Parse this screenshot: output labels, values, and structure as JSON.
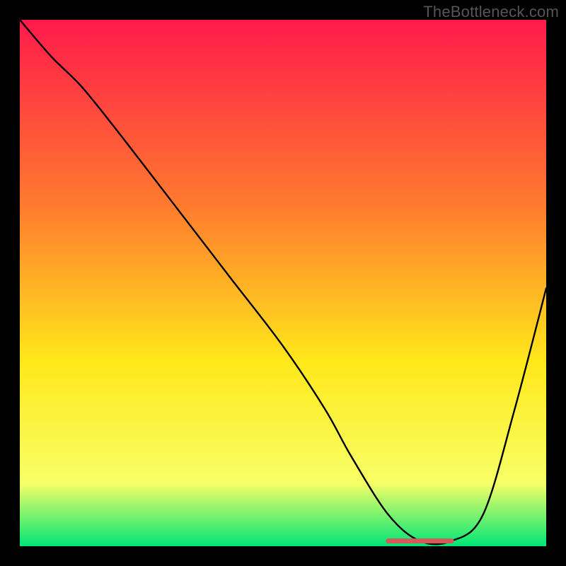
{
  "watermark": "TheBottleneck.com",
  "colors": {
    "background": "#000000",
    "gradient_top": "#ff1a4b",
    "gradient_mid1": "#ff7a2e",
    "gradient_mid2": "#ffe81a",
    "gradient_mid3": "#f7ff66",
    "gradient_bottom": "#00e676",
    "curve": "#000000",
    "flat_highlight": "#d65a5a"
  },
  "chart_data": {
    "type": "line",
    "title": "",
    "xlabel": "",
    "ylabel": "",
    "xlim": [
      0,
      100
    ],
    "ylim": [
      0,
      100
    ],
    "x": [
      0,
      6,
      12,
      20,
      30,
      40,
      50,
      58,
      63,
      70,
      76,
      82,
      88,
      94,
      100
    ],
    "y": [
      100,
      93,
      87,
      77,
      64,
      51,
      38,
      26,
      17,
      6,
      1,
      1,
      6,
      26,
      49
    ],
    "flat_region": {
      "x_start": 70,
      "x_end": 82,
      "y": 1
    },
    "annotations": []
  }
}
